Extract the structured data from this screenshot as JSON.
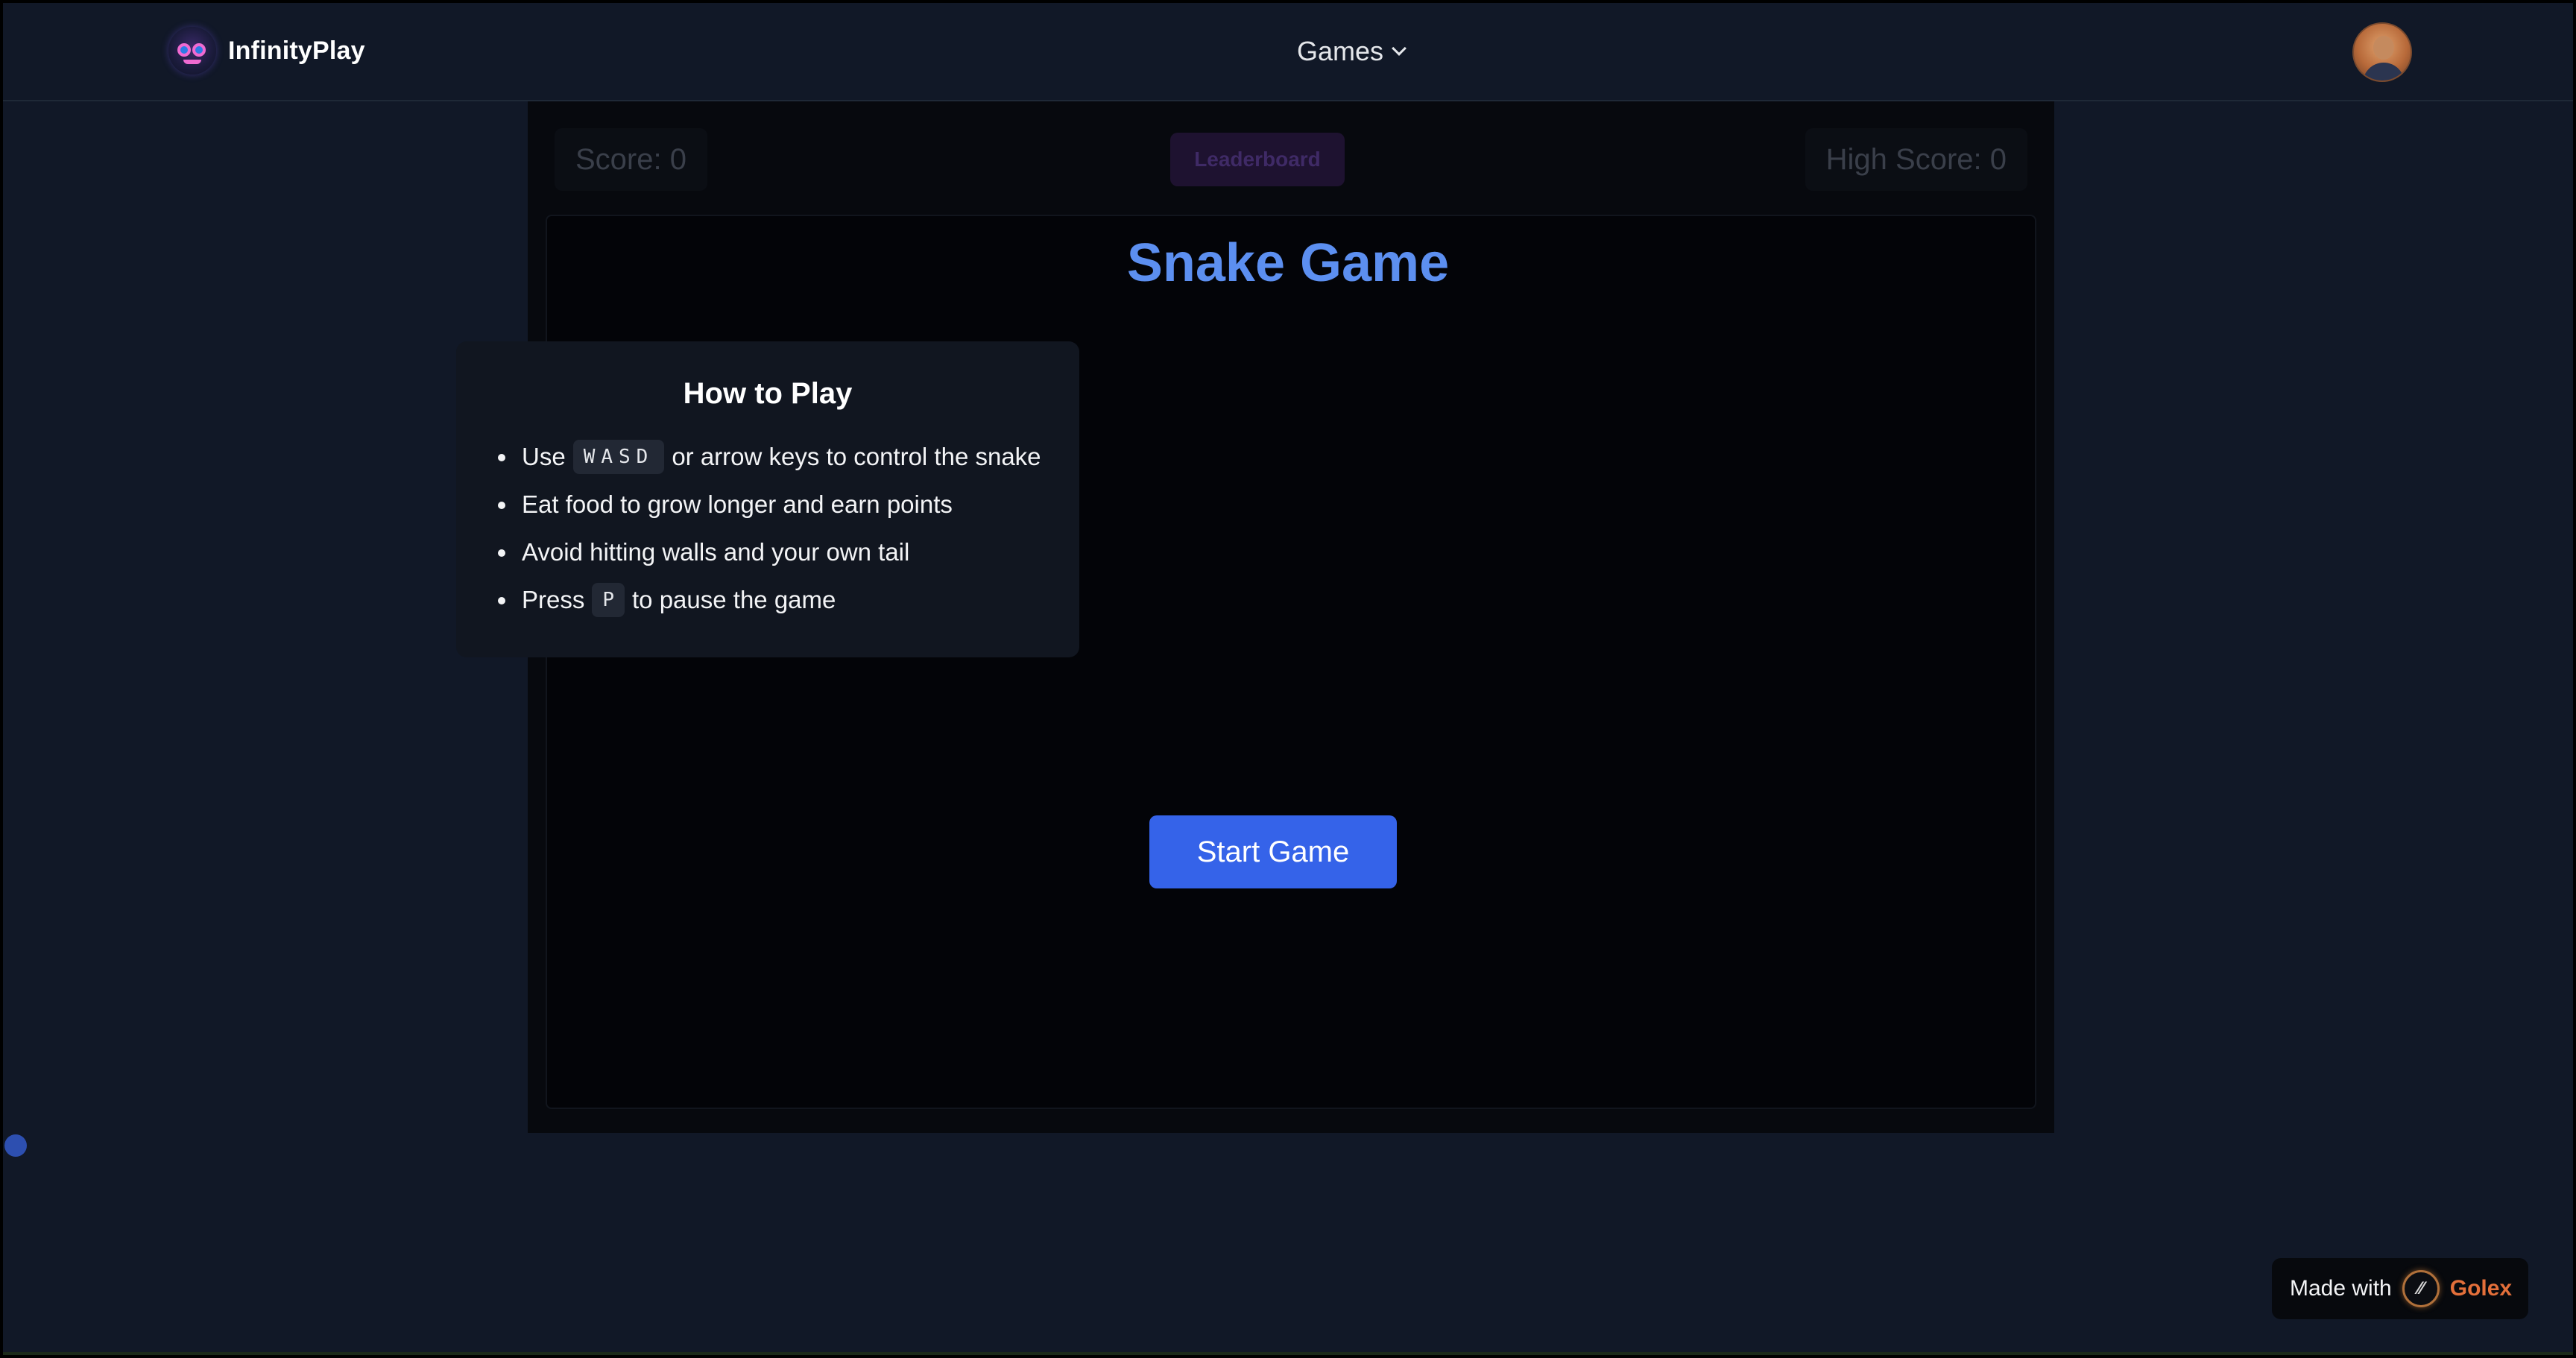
{
  "navbar": {
    "brand_name": "InfinityPlay",
    "menu_label": "Games",
    "icons": {
      "logo": "infinityplay-logo-icon",
      "menu_chevron": "chevron-down-icon",
      "avatar": "user-avatar"
    }
  },
  "game": {
    "score_text": "Score: 0",
    "leaderboard_label": "Leaderboard",
    "high_score_text": "High Score: 0",
    "title": "Snake Game",
    "howto": {
      "title": "How to Play",
      "items": [
        {
          "before": "Use",
          "key": "WASD",
          "after": "or arrow keys to control the snake"
        },
        {
          "text": "Eat food to grow longer and earn points"
        },
        {
          "text": "Avoid hitting walls and your own tail"
        },
        {
          "before": "Press",
          "key": "P",
          "after": "to pause the game"
        }
      ]
    },
    "start_label": "Start Game"
  },
  "badge": {
    "made_with": "Made with",
    "brand": "Golex",
    "logo_glyph": "⁄⁄"
  },
  "colors": {
    "page_bg": "#111827",
    "title_blue": "#5c8ff0",
    "start_button": "#3563e9",
    "golex_orange": "#e36f3a"
  }
}
